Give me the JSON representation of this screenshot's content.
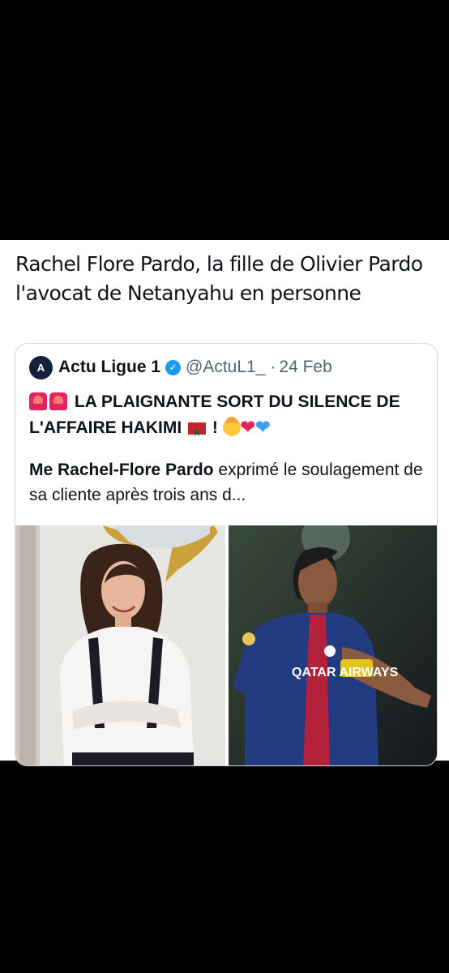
{
  "tweet": {
    "text": "Rachel Flore Pardo, la fille de Olivier Pardo l'avocat de Netanyahu en personne"
  },
  "quote": {
    "avatar": "A",
    "name": "Actu Ligue 1",
    "handle": "@ActuL1_",
    "separator": "·",
    "date": "24 Feb",
    "headline": "LA PLAIGNANTE SORT DU SILENCE DE L'AFFAIRE HAKIMI",
    "headline_suffix": " ! ",
    "body_bold": "Me Rachel-Flore Pardo",
    "body_rest": " exprimé le soulagement de sa cliente après trois ans d..."
  },
  "icons": {
    "siren": "police-car-light-icon",
    "flag": "morocco-flag-icon",
    "face": "exploding-head-icon",
    "heart_red": "red-heart-icon",
    "heart_blue": "blue-heart-icon",
    "verified": "verified-badge-icon"
  },
  "media_images": [
    {
      "description": "woman-portrait-photo"
    },
    {
      "description": "footballer-psg-photo",
      "jersey_text": "QATAR AIRWAYS"
    }
  ],
  "colors": {
    "background": "#000000",
    "card": "#ffffff",
    "text": "#0f1419",
    "secondary": "#536471",
    "verified": "#1d9bf0"
  }
}
